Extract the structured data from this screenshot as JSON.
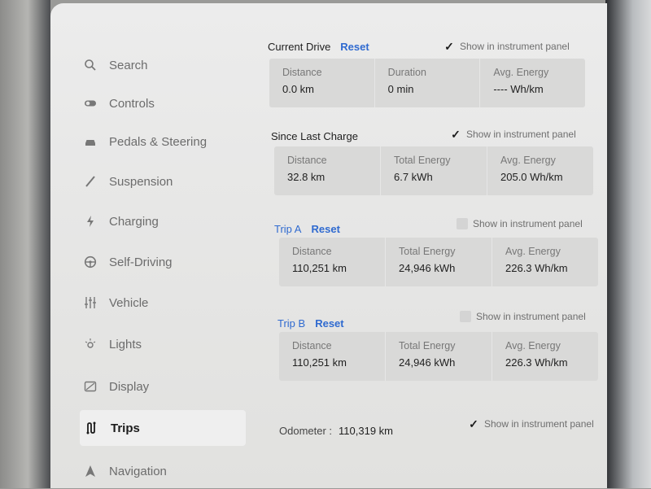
{
  "sidebar": {
    "items": [
      {
        "label": "Search",
        "icon": "search-icon"
      },
      {
        "label": "Controls",
        "icon": "toggle-icon"
      },
      {
        "label": "Pedals & Steering",
        "icon": "car-icon"
      },
      {
        "label": "Suspension",
        "icon": "suspension-icon"
      },
      {
        "label": "Charging",
        "icon": "lightning-icon"
      },
      {
        "label": "Self-Driving",
        "icon": "steering-wheel-icon"
      },
      {
        "label": "Vehicle",
        "icon": "sliders-icon"
      },
      {
        "label": "Lights",
        "icon": "light-icon"
      },
      {
        "label": "Display",
        "icon": "display-icon"
      },
      {
        "label": "Trips",
        "icon": "trips-icon"
      },
      {
        "label": "Navigation",
        "icon": "navigation-icon"
      }
    ],
    "active": "Trips"
  },
  "current_drive": {
    "title": "Current Drive",
    "reset": "Reset",
    "show_label": "Show in instrument panel",
    "show_checked": true,
    "cells": [
      {
        "label": "Distance",
        "value": "0.0 km"
      },
      {
        "label": "Duration",
        "value": "0 min"
      },
      {
        "label": "Avg. Energy",
        "value": "---- Wh/km"
      }
    ]
  },
  "since_last_charge": {
    "title": "Since Last Charge",
    "show_label": "Show in instrument panel",
    "show_checked": true,
    "cells": [
      {
        "label": "Distance",
        "value": "32.8 km"
      },
      {
        "label": "Total Energy",
        "value": "6.7 kWh"
      },
      {
        "label": "Avg. Energy",
        "value": "205.0 Wh/km"
      }
    ]
  },
  "trip_a": {
    "title": "Trip A",
    "reset": "Reset",
    "show_label": "Show in instrument panel",
    "show_checked": false,
    "cells": [
      {
        "label": "Distance",
        "value": "110,251 km"
      },
      {
        "label": "Total Energy",
        "value": "24,946 kWh"
      },
      {
        "label": "Avg. Energy",
        "value": "226.3 Wh/km"
      }
    ]
  },
  "trip_b": {
    "title": "Trip B",
    "reset": "Reset",
    "show_label": "Show in instrument panel",
    "show_checked": false,
    "cells": [
      {
        "label": "Distance",
        "value": "110,251 km"
      },
      {
        "label": "Total Energy",
        "value": "24,946 kWh"
      },
      {
        "label": "Avg. Energy",
        "value": "226.3 Wh/km"
      }
    ]
  },
  "odometer": {
    "label": "Odometer :",
    "value": "110,319 km",
    "show_label": "Show in instrument panel",
    "show_checked": true
  },
  "colors": {
    "accent": "#2f6ad0",
    "panel": "#d9d9d8",
    "background": "#e6e6e5"
  }
}
